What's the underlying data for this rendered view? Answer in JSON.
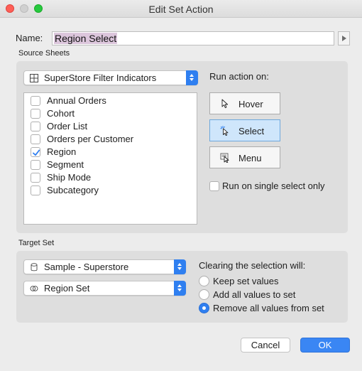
{
  "window": {
    "title": "Edit Set Action"
  },
  "name": {
    "label": "Name:",
    "value": "Region Select"
  },
  "source_sheets": {
    "section_label": "Source Sheets",
    "sheet_selector": {
      "value": "SuperStore Filter Indicators",
      "icon": "grid-icon"
    },
    "sheets": [
      {
        "label": "Annual Orders",
        "checked": false
      },
      {
        "label": "Cohort",
        "checked": false
      },
      {
        "label": "Order List",
        "checked": false
      },
      {
        "label": "Orders per Customer",
        "checked": false
      },
      {
        "label": "Region",
        "checked": true
      },
      {
        "label": "Segment",
        "checked": false
      },
      {
        "label": "Ship Mode",
        "checked": false
      },
      {
        "label": "Subcategory",
        "checked": false
      }
    ],
    "run_action_label": "Run action on:",
    "run_buttons": [
      {
        "label": "Hover",
        "icon": "pointer-icon",
        "selected": false
      },
      {
        "label": "Select",
        "icon": "pointer-click-icon",
        "selected": true
      },
      {
        "label": "Menu",
        "icon": "pointer-menu-icon",
        "selected": false
      }
    ],
    "single_select": {
      "label": "Run on single select only",
      "checked": false
    }
  },
  "target_set": {
    "section_label": "Target Set",
    "data_source": {
      "value": "Sample - Superstore",
      "icon": "database-icon"
    },
    "set": {
      "value": "Region Set",
      "icon": "set-icon"
    },
    "clearing_label": "Clearing the selection will:",
    "options": [
      {
        "label": "Keep set values",
        "selected": false
      },
      {
        "label": "Add all values to set",
        "selected": false
      },
      {
        "label": "Remove all values from set",
        "selected": true
      }
    ]
  },
  "buttons": {
    "cancel": "Cancel",
    "ok": "OK"
  },
  "colors": {
    "accent": "#2f7ff0",
    "selected_button": "#cfe6fb",
    "name_highlight": "#dcc6dc"
  }
}
